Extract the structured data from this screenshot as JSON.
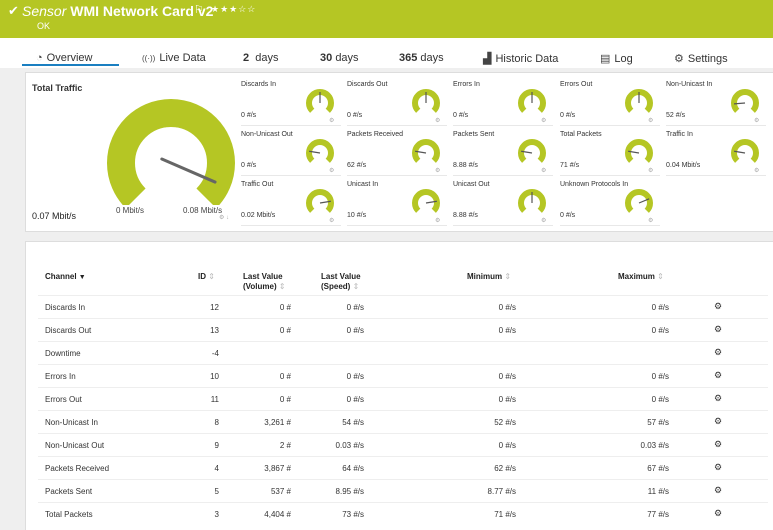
{
  "header": {
    "check_icon": "check-icon",
    "title_prefix": "Sensor",
    "title": "WMI Network Card v2",
    "flag_icon": "flag-icon",
    "stars": "★★★☆☆",
    "status": "OK",
    "background": "#b5c624"
  },
  "tabs": [
    {
      "label": "Overview",
      "icon": "overview-icon",
      "glyph": "◔"
    },
    {
      "label": "Live Data",
      "icon": "live-data-icon",
      "glyph": "((·))"
    },
    {
      "label": "days",
      "value": "2"
    },
    {
      "label": "days",
      "value": "30"
    },
    {
      "label": "days",
      "value": "365"
    },
    {
      "label": "Historic Data",
      "icon": "historic-data-icon",
      "glyph": "▟"
    },
    {
      "label": "Log",
      "icon": "log-icon",
      "glyph": "▤"
    },
    {
      "label": "Settings",
      "icon": "settings-icon",
      "glyph": "⚙"
    }
  ],
  "big_gauge": {
    "title": "Total Traffic",
    "value": "0.07 Mbit/s",
    "min_label": "0 Mbit/s",
    "max_label": "0.08 Mbit/s",
    "level": 0.92,
    "color": "#b5c624"
  },
  "small_gauges": [
    {
      "label": "Discards In",
      "value": "0 #/s",
      "level": 0.5
    },
    {
      "label": "Discards Out",
      "value": "0 #/s",
      "level": 0.5
    },
    {
      "label": "Errors In",
      "value": "0 #/s",
      "level": 0.5
    },
    {
      "label": "Errors Out",
      "value": "0 #/s",
      "level": 0.5
    },
    {
      "label": "Non-Unicast In",
      "value": "52 #/s",
      "level": 0.15
    },
    {
      "label": "Non-Unicast Out",
      "value": "0 #/s",
      "level": 0.2
    },
    {
      "label": "Packets Received",
      "value": "62 #/s",
      "level": 0.2
    },
    {
      "label": "Packets Sent",
      "value": "8.88 #/s",
      "level": 0.2
    },
    {
      "label": "Total Packets",
      "value": "71 #/s",
      "level": 0.2
    },
    {
      "label": "Traffic In",
      "value": "0.04 Mbit/s",
      "level": 0.2
    },
    {
      "label": "Traffic Out",
      "value": "0.02 Mbit/s",
      "level": 0.8
    },
    {
      "label": "Unicast In",
      "value": "10 #/s",
      "level": 0.8
    },
    {
      "label": "Unicast Out",
      "value": "8.88 #/s",
      "level": 0.5
    },
    {
      "label": "Unknown Protocols In",
      "value": "0 #/s",
      "level": 0.75
    }
  ],
  "table": {
    "headers": {
      "channel": "Channel",
      "id": "ID",
      "last_value_volume": "Last Value (Volume)",
      "last_value_speed": "Last Value (Speed)",
      "minimum": "Minimum",
      "maximum": "Maximum"
    },
    "sort_icon": "sort-icon",
    "action_icon": "settings-gears-icon",
    "rows": [
      {
        "channel": "Discards In",
        "id": "12",
        "volume": "0 #",
        "speed": "0 #/s",
        "min": "0 #/s",
        "max": "0 #/s"
      },
      {
        "channel": "Discards Out",
        "id": "13",
        "volume": "0 #",
        "speed": "0 #/s",
        "min": "0 #/s",
        "max": "0 #/s"
      },
      {
        "channel": "Downtime",
        "id": "-4",
        "volume": "",
        "speed": "",
        "min": "",
        "max": ""
      },
      {
        "channel": "Errors In",
        "id": "10",
        "volume": "0 #",
        "speed": "0 #/s",
        "min": "0 #/s",
        "max": "0 #/s"
      },
      {
        "channel": "Errors Out",
        "id": "11",
        "volume": "0 #",
        "speed": "0 #/s",
        "min": "0 #/s",
        "max": "0 #/s"
      },
      {
        "channel": "Non-Unicast In",
        "id": "8",
        "volume": "3,261 #",
        "speed": "54 #/s",
        "min": "52 #/s",
        "max": "57 #/s"
      },
      {
        "channel": "Non-Unicast Out",
        "id": "9",
        "volume": "2 #",
        "speed": "0.03 #/s",
        "min": "0 #/s",
        "max": "0.03 #/s"
      },
      {
        "channel": "Packets Received",
        "id": "4",
        "volume": "3,867 #",
        "speed": "64 #/s",
        "min": "62 #/s",
        "max": "67 #/s"
      },
      {
        "channel": "Packets Sent",
        "id": "5",
        "volume": "537 #",
        "speed": "8.95 #/s",
        "min": "8.77 #/s",
        "max": "11 #/s"
      },
      {
        "channel": "Total Packets",
        "id": "3",
        "volume": "4,404 #",
        "speed": "73 #/s",
        "min": "71 #/s",
        "max": "77 #/s"
      }
    ]
  }
}
